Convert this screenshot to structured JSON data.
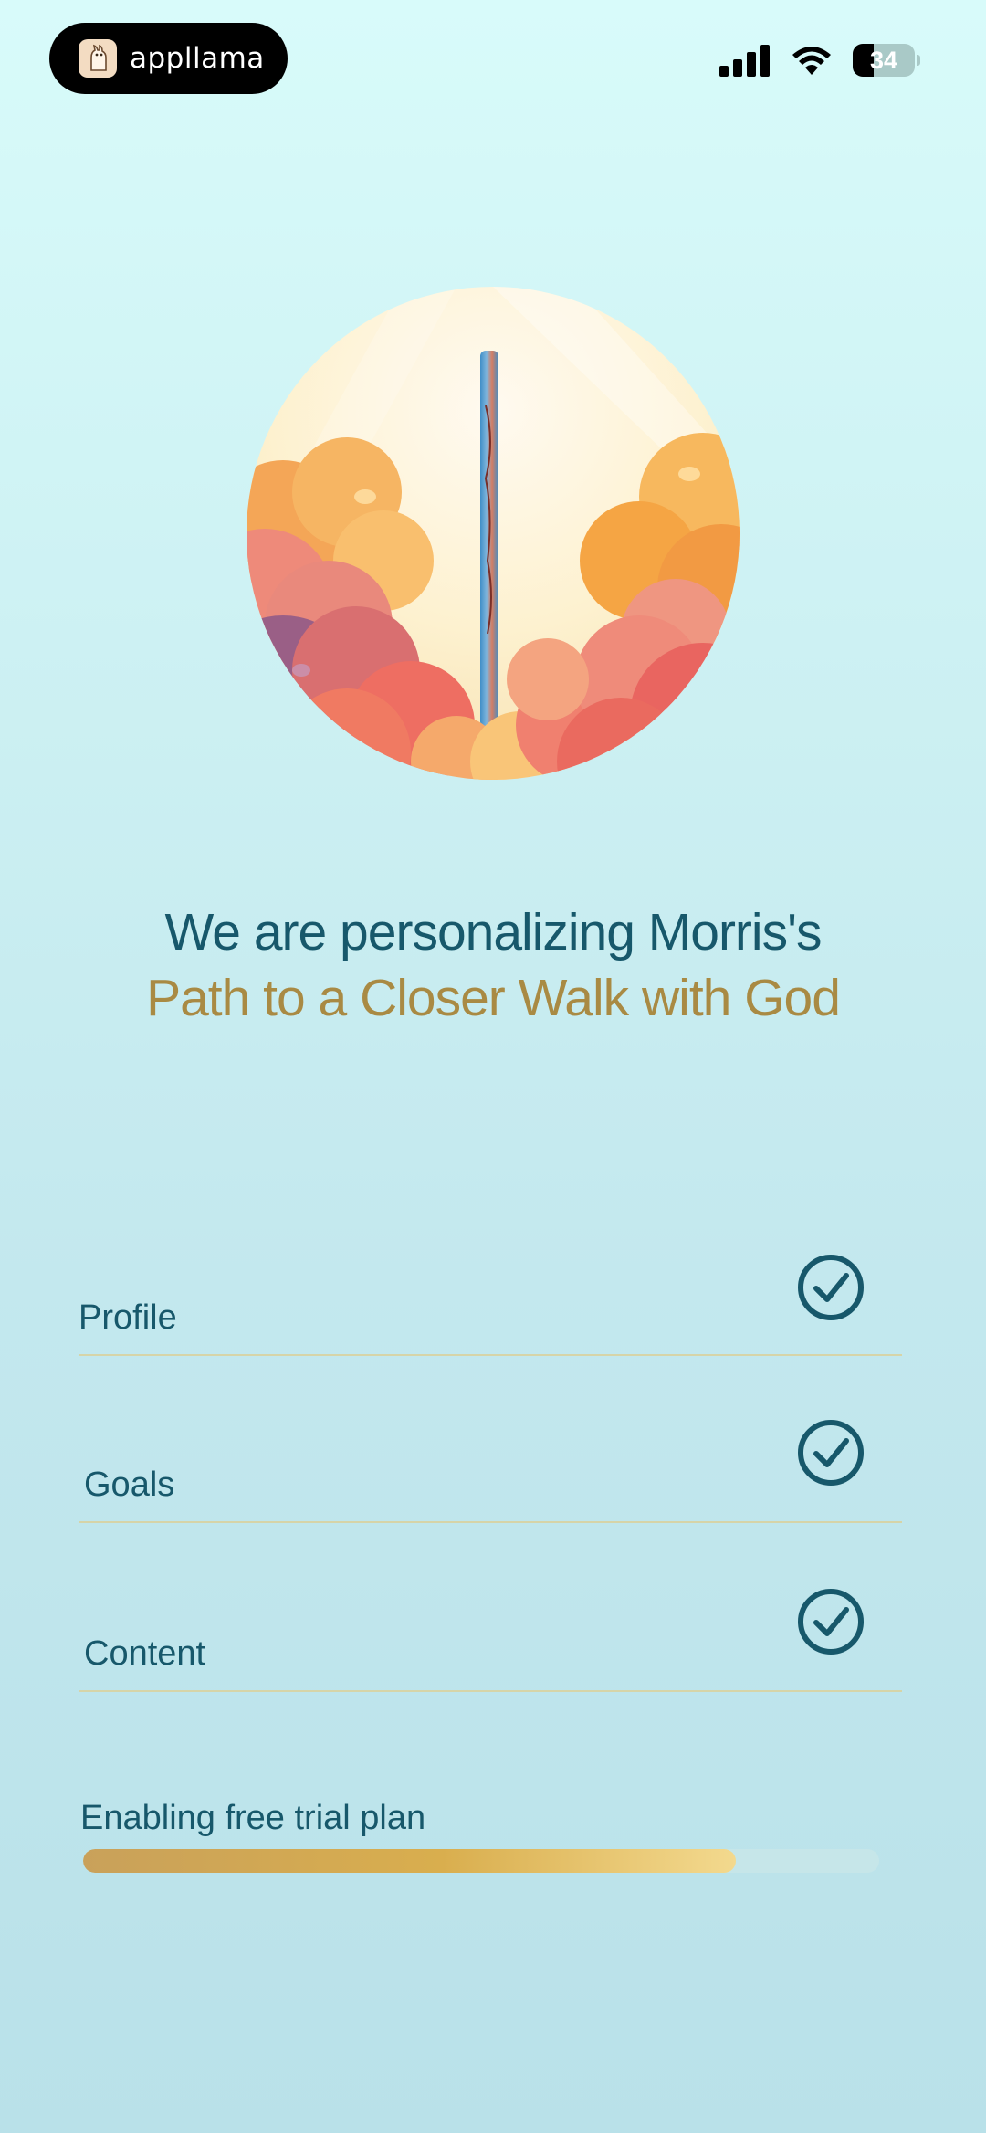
{
  "status_bar": {
    "app_badge": "appllama",
    "battery": "34",
    "battery_level": 0.34
  },
  "hero": {
    "icon": "sky-clouds-illustration"
  },
  "heading": {
    "line1": "We are personalizing Morris's",
    "line2": "Path to a Closer Walk with God"
  },
  "checklist": [
    {
      "label": "Profile",
      "done": true
    },
    {
      "label": "Goals",
      "done": true
    },
    {
      "label": "Content",
      "done": true
    }
  ],
  "progress": {
    "label": "Enabling free trial plan",
    "value": 0.82
  },
  "colors": {
    "primary": "#17586b",
    "accent_gold": "#a98a43",
    "divider": "#d6d4a8"
  }
}
